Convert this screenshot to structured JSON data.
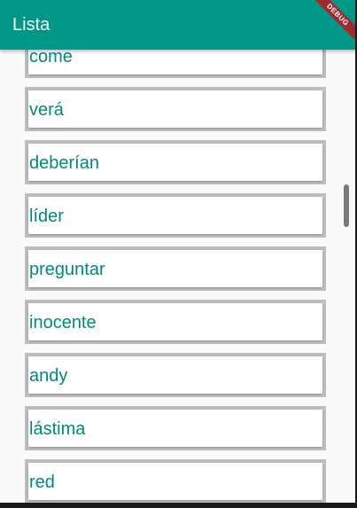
{
  "app_bar": {
    "title": "Lista",
    "color": "#009688"
  },
  "debug_banner": {
    "label": "DEBUG",
    "color": "#a0282e"
  },
  "list": {
    "text_color": "#00897b",
    "border_color": "#bdbdbd",
    "items": [
      {
        "label": "come"
      },
      {
        "label": "verá"
      },
      {
        "label": "deberían"
      },
      {
        "label": "líder"
      },
      {
        "label": "preguntar"
      },
      {
        "label": "inocente"
      },
      {
        "label": "andy"
      },
      {
        "label": "lástima"
      },
      {
        "label": "red"
      }
    ]
  }
}
